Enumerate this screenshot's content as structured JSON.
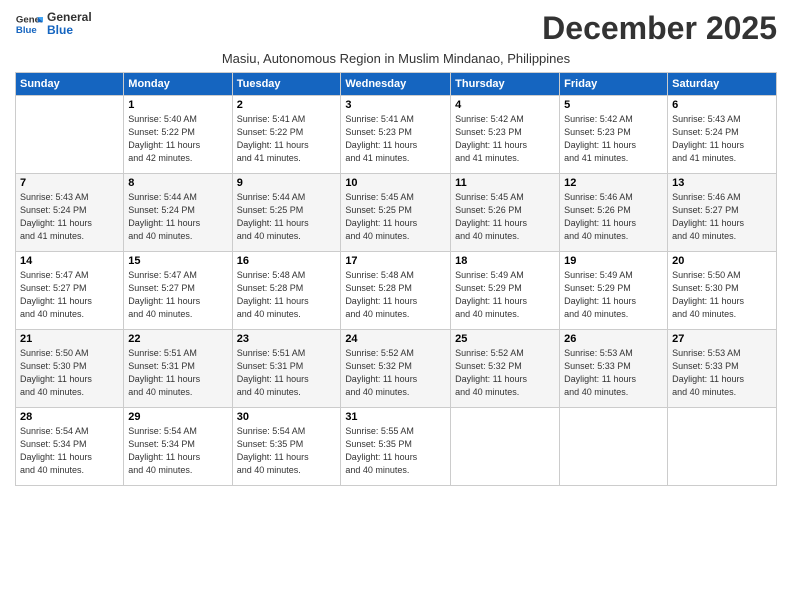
{
  "logo": {
    "line1": "General",
    "line2": "Blue"
  },
  "title": "December 2025",
  "subtitle": "Masiu, Autonomous Region in Muslim Mindanao, Philippines",
  "days_of_week": [
    "Sunday",
    "Monday",
    "Tuesday",
    "Wednesday",
    "Thursday",
    "Friday",
    "Saturday"
  ],
  "weeks": [
    [
      {
        "num": "",
        "info": ""
      },
      {
        "num": "1",
        "info": "Sunrise: 5:40 AM\nSunset: 5:22 PM\nDaylight: 11 hours\nand 42 minutes."
      },
      {
        "num": "2",
        "info": "Sunrise: 5:41 AM\nSunset: 5:22 PM\nDaylight: 11 hours\nand 41 minutes."
      },
      {
        "num": "3",
        "info": "Sunrise: 5:41 AM\nSunset: 5:23 PM\nDaylight: 11 hours\nand 41 minutes."
      },
      {
        "num": "4",
        "info": "Sunrise: 5:42 AM\nSunset: 5:23 PM\nDaylight: 11 hours\nand 41 minutes."
      },
      {
        "num": "5",
        "info": "Sunrise: 5:42 AM\nSunset: 5:23 PM\nDaylight: 11 hours\nand 41 minutes."
      },
      {
        "num": "6",
        "info": "Sunrise: 5:43 AM\nSunset: 5:24 PM\nDaylight: 11 hours\nand 41 minutes."
      }
    ],
    [
      {
        "num": "7",
        "info": "Sunrise: 5:43 AM\nSunset: 5:24 PM\nDaylight: 11 hours\nand 41 minutes."
      },
      {
        "num": "8",
        "info": "Sunrise: 5:44 AM\nSunset: 5:24 PM\nDaylight: 11 hours\nand 40 minutes."
      },
      {
        "num": "9",
        "info": "Sunrise: 5:44 AM\nSunset: 5:25 PM\nDaylight: 11 hours\nand 40 minutes."
      },
      {
        "num": "10",
        "info": "Sunrise: 5:45 AM\nSunset: 5:25 PM\nDaylight: 11 hours\nand 40 minutes."
      },
      {
        "num": "11",
        "info": "Sunrise: 5:45 AM\nSunset: 5:26 PM\nDaylight: 11 hours\nand 40 minutes."
      },
      {
        "num": "12",
        "info": "Sunrise: 5:46 AM\nSunset: 5:26 PM\nDaylight: 11 hours\nand 40 minutes."
      },
      {
        "num": "13",
        "info": "Sunrise: 5:46 AM\nSunset: 5:27 PM\nDaylight: 11 hours\nand 40 minutes."
      }
    ],
    [
      {
        "num": "14",
        "info": "Sunrise: 5:47 AM\nSunset: 5:27 PM\nDaylight: 11 hours\nand 40 minutes."
      },
      {
        "num": "15",
        "info": "Sunrise: 5:47 AM\nSunset: 5:27 PM\nDaylight: 11 hours\nand 40 minutes."
      },
      {
        "num": "16",
        "info": "Sunrise: 5:48 AM\nSunset: 5:28 PM\nDaylight: 11 hours\nand 40 minutes."
      },
      {
        "num": "17",
        "info": "Sunrise: 5:48 AM\nSunset: 5:28 PM\nDaylight: 11 hours\nand 40 minutes."
      },
      {
        "num": "18",
        "info": "Sunrise: 5:49 AM\nSunset: 5:29 PM\nDaylight: 11 hours\nand 40 minutes."
      },
      {
        "num": "19",
        "info": "Sunrise: 5:49 AM\nSunset: 5:29 PM\nDaylight: 11 hours\nand 40 minutes."
      },
      {
        "num": "20",
        "info": "Sunrise: 5:50 AM\nSunset: 5:30 PM\nDaylight: 11 hours\nand 40 minutes."
      }
    ],
    [
      {
        "num": "21",
        "info": "Sunrise: 5:50 AM\nSunset: 5:30 PM\nDaylight: 11 hours\nand 40 minutes."
      },
      {
        "num": "22",
        "info": "Sunrise: 5:51 AM\nSunset: 5:31 PM\nDaylight: 11 hours\nand 40 minutes."
      },
      {
        "num": "23",
        "info": "Sunrise: 5:51 AM\nSunset: 5:31 PM\nDaylight: 11 hours\nand 40 minutes."
      },
      {
        "num": "24",
        "info": "Sunrise: 5:52 AM\nSunset: 5:32 PM\nDaylight: 11 hours\nand 40 minutes."
      },
      {
        "num": "25",
        "info": "Sunrise: 5:52 AM\nSunset: 5:32 PM\nDaylight: 11 hours\nand 40 minutes."
      },
      {
        "num": "26",
        "info": "Sunrise: 5:53 AM\nSunset: 5:33 PM\nDaylight: 11 hours\nand 40 minutes."
      },
      {
        "num": "27",
        "info": "Sunrise: 5:53 AM\nSunset: 5:33 PM\nDaylight: 11 hours\nand 40 minutes."
      }
    ],
    [
      {
        "num": "28",
        "info": "Sunrise: 5:54 AM\nSunset: 5:34 PM\nDaylight: 11 hours\nand 40 minutes."
      },
      {
        "num": "29",
        "info": "Sunrise: 5:54 AM\nSunset: 5:34 PM\nDaylight: 11 hours\nand 40 minutes."
      },
      {
        "num": "30",
        "info": "Sunrise: 5:54 AM\nSunset: 5:35 PM\nDaylight: 11 hours\nand 40 minutes."
      },
      {
        "num": "31",
        "info": "Sunrise: 5:55 AM\nSunset: 5:35 PM\nDaylight: 11 hours\nand 40 minutes."
      },
      {
        "num": "",
        "info": ""
      },
      {
        "num": "",
        "info": ""
      },
      {
        "num": "",
        "info": ""
      }
    ]
  ]
}
